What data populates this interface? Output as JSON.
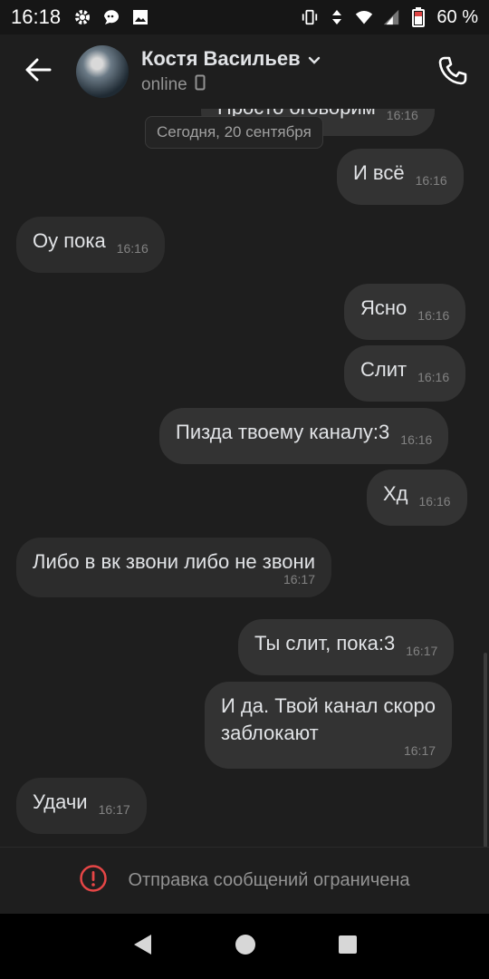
{
  "status_bar": {
    "time": "16:18",
    "battery": "60 %",
    "icons": [
      "gear-icon",
      "chat-bubble-icon",
      "image-icon",
      "vibrate-icon",
      "data-arrows-icon",
      "wifi-icon",
      "signal-icon",
      "battery-icon"
    ]
  },
  "header": {
    "contact_name": "Костя Васильев",
    "status": "online",
    "status_device": "phone-icon"
  },
  "chat": {
    "partial_message": {
      "text": "Просто оговорим",
      "time": "16:16"
    },
    "date_pill": "Сегодня, 20 сентября",
    "messages": [
      {
        "direction": "out",
        "text": "И всё",
        "time": "16:16"
      },
      {
        "direction": "in",
        "text": "Оу пока",
        "time": "16:16"
      },
      {
        "direction": "out",
        "text": "Ясно",
        "time": "16:16"
      },
      {
        "direction": "out",
        "text": "Слит",
        "time": "16:16"
      },
      {
        "direction": "out",
        "text": "Пизда твоему каналу:3",
        "time": "16:16"
      },
      {
        "direction": "out",
        "text": "Хд",
        "time": "16:16"
      },
      {
        "direction": "in",
        "text": "Либо в вк звони либо не звони",
        "time": "16:17"
      },
      {
        "direction": "out",
        "text": "Ты слит, пока:3",
        "time": "16:17"
      },
      {
        "direction": "out",
        "line1": "И да. Твой канал скоро",
        "line2": "заблокают",
        "time": "16:17"
      },
      {
        "direction": "in",
        "text": "Удачи",
        "time": "16:17"
      }
    ]
  },
  "restriction_notice": "Отправка сообщений ограничена",
  "colors": {
    "background": "#1e1e1e",
    "bubble_out": "#333333",
    "bubble_in": "#2c2c2c",
    "warning": "#e64646",
    "secondary_text": "#939393"
  }
}
